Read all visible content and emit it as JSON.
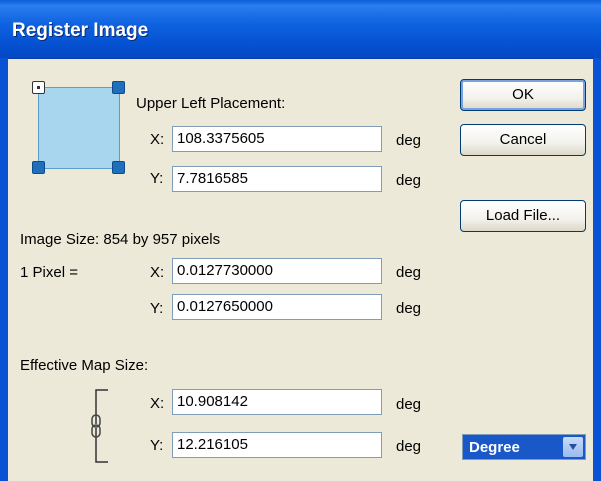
{
  "window": {
    "title": "Register Image"
  },
  "upper_left": {
    "heading": "Upper Left Placement:",
    "x_label": "X:",
    "x_value": "108.3375605",
    "x_unit": "deg",
    "y_label": "Y:",
    "y_value": "7.7816585",
    "y_unit": "deg"
  },
  "image_size": {
    "text": "Image Size: 854 by 957 pixels"
  },
  "pixel": {
    "label": "1 Pixel =",
    "x_label": "X:",
    "x_value": "0.0127730000",
    "x_unit": "deg",
    "y_label": "Y:",
    "y_value": "0.0127650000",
    "y_unit": "deg"
  },
  "effective": {
    "heading": "Effective Map Size:",
    "x_label": "X:",
    "x_value": "10.908142",
    "x_unit": "deg",
    "y_label": "Y:",
    "y_value": "12.216105",
    "y_unit": "deg"
  },
  "buttons": {
    "ok": "OK",
    "cancel": "Cancel",
    "load_file": "Load File..."
  },
  "units_select": {
    "selected": "Degree"
  },
  "icons": {
    "placement": "placement-square-icon",
    "link": "chain-link-icon",
    "dropdown": "chevron-down-icon"
  }
}
